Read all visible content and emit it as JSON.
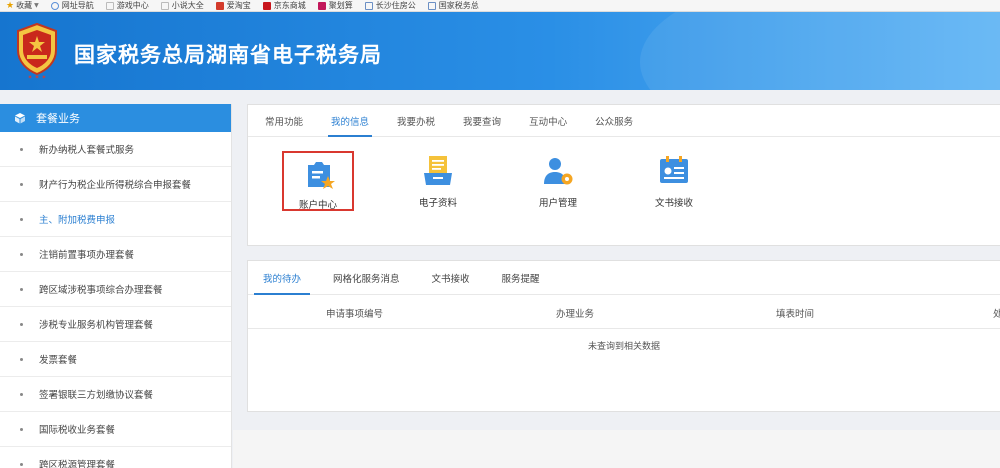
{
  "bookmarks": [
    {
      "label": "收藏",
      "icon": "star-icon"
    },
    {
      "label": "网址导航",
      "icon": "globe-icon",
      "color": "#5a8fd8"
    },
    {
      "label": "游戏中心",
      "icon": "page-icon",
      "color": "#bbbbbb"
    },
    {
      "label": "小说大全",
      "icon": "page-icon",
      "color": "#bbbbbb"
    },
    {
      "label": "爱淘宝",
      "icon": "taobao-icon",
      "color": "#d33b2c"
    },
    {
      "label": "京东商城",
      "icon": "jd-icon",
      "color": "#c8161d"
    },
    {
      "label": "聚划算",
      "icon": "juhuasuan-icon",
      "color": "#c2185b"
    },
    {
      "label": "长沙住房公",
      "icon": "page-icon",
      "color": "#6b8fc4"
    },
    {
      "label": "国家税务总",
      "icon": "page-icon",
      "color": "#6b8fc4"
    }
  ],
  "header": {
    "title": "国家税务总局湖南省电子税务局"
  },
  "sidebar": {
    "header": "套餐业务",
    "items": [
      "新办纳税人套餐式服务",
      "财产行为税企业所得税综合申报套餐",
      "主、附加税费申报",
      "注销前置事项办理套餐",
      "跨区域涉税事项综合办理套餐",
      "涉税专业服务机构管理套餐",
      "发票套餐",
      "签署银联三方划缴协议套餐",
      "国际税收业务套餐",
      "跨区税源管理套餐"
    ],
    "active_index": 2
  },
  "top_panel": {
    "tabs": [
      "常用功能",
      "我的信息",
      "我要办税",
      "我要查询",
      "互动中心",
      "公众服务"
    ],
    "active_tab": 1,
    "functions": [
      {
        "label": "账户中心",
        "icon": "account-center-icon",
        "highlighted": true
      },
      {
        "label": "电子资料",
        "icon": "electronic-documents-icon"
      },
      {
        "label": "用户管理",
        "icon": "user-management-icon"
      },
      {
        "label": "文书接收",
        "icon": "document-receive-icon"
      }
    ]
  },
  "bottom_panel": {
    "tabs": [
      "我的待办",
      "网格化服务消息",
      "文书接收",
      "服务提醒"
    ],
    "active_tab": 0,
    "columns": [
      "申请事项编号",
      "办理业务",
      "填表时间",
      "处"
    ],
    "empty_text": "未查询到相关数据"
  },
  "colors": {
    "accent": "#2b7fd1",
    "banner": "#1675cf",
    "highlight_border": "#d9382f"
  }
}
